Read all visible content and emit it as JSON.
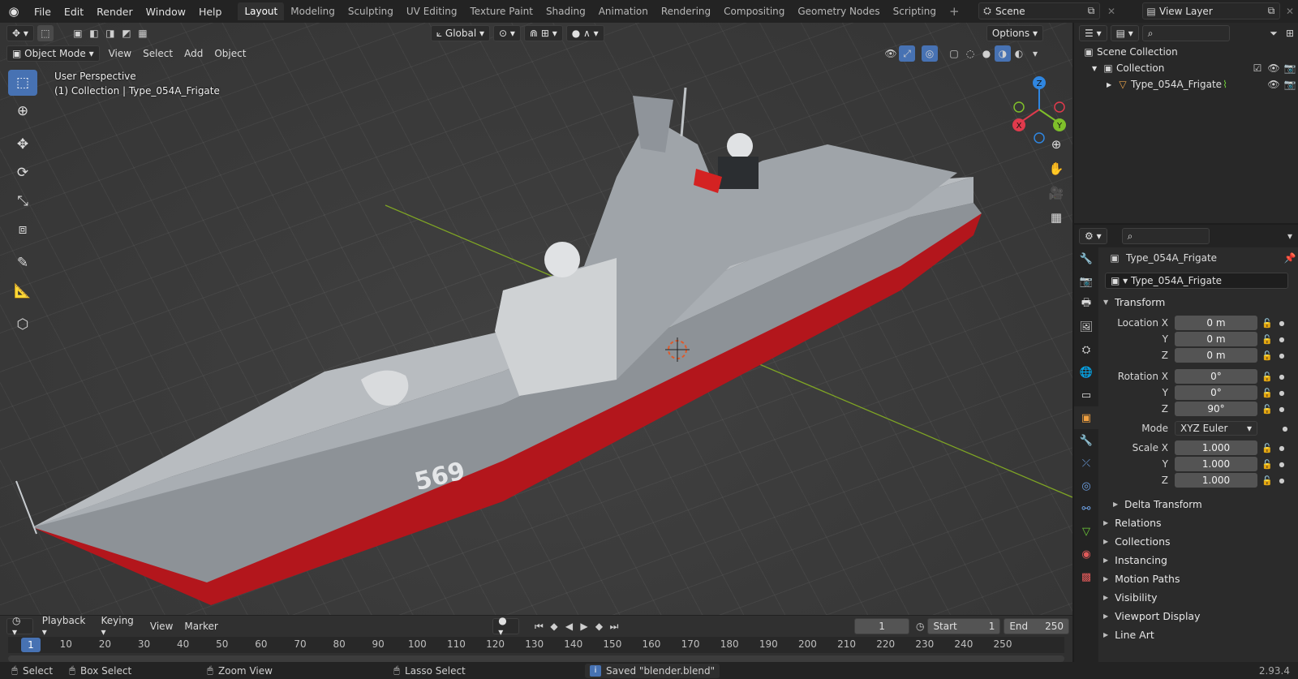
{
  "topbar": {
    "menus": [
      "File",
      "Edit",
      "Render",
      "Window",
      "Help"
    ],
    "workspaces": [
      "Layout",
      "Modeling",
      "Sculpting",
      "UV Editing",
      "Texture Paint",
      "Shading",
      "Animation",
      "Rendering",
      "Compositing",
      "Geometry Nodes",
      "Scripting"
    ],
    "active_workspace": "Layout",
    "scene": "Scene",
    "view_layer": "View Layer"
  },
  "viewport": {
    "orientation": "Global",
    "options_label": "Options",
    "mode": "Object Mode",
    "menus": [
      "View",
      "Select",
      "Add",
      "Object"
    ],
    "perspective_label": "User Perspective",
    "collection_label": "(1) Collection | Type_054A_Frigate",
    "hull_number": "569",
    "gizmo": {
      "z": "Z",
      "x": "X",
      "y": "Y"
    }
  },
  "outliner": {
    "scene_collection": "Scene Collection",
    "collection": "Collection",
    "object": "Type_054A_Frigate"
  },
  "properties": {
    "object_name": "Type_054A_Frigate",
    "data_name": "Type_054A_Frigate",
    "transform_label": "Transform",
    "location": {
      "label_x": "Location X",
      "label_y": "Y",
      "label_z": "Z",
      "x": "0 m",
      "y": "0 m",
      "z": "0 m"
    },
    "rotation": {
      "label_x": "Rotation X",
      "label_y": "Y",
      "label_z": "Z",
      "x": "0°",
      "y": "0°",
      "z": "90°"
    },
    "mode_label": "Mode",
    "mode_value": "XYZ Euler",
    "scale": {
      "label_x": "Scale X",
      "label_y": "Y",
      "label_z": "Z",
      "x": "1.000",
      "y": "1.000",
      "z": "1.000"
    },
    "delta_transform": "Delta Transform",
    "sections": [
      "Relations",
      "Collections",
      "Instancing",
      "Motion Paths",
      "Visibility",
      "Viewport Display",
      "Line Art"
    ]
  },
  "timeline": {
    "menus": [
      "Playback",
      "Keying",
      "View",
      "Marker"
    ],
    "current_frame": "1",
    "start_label": "Start",
    "start": "1",
    "end_label": "End",
    "end": "250",
    "ticks": [
      "1",
      "10",
      "20",
      "30",
      "40",
      "50",
      "60",
      "70",
      "80",
      "90",
      "100",
      "110",
      "120",
      "130",
      "140",
      "150",
      "160",
      "170",
      "180",
      "190",
      "200",
      "210",
      "220",
      "230",
      "240",
      "250"
    ]
  },
  "statusbar": {
    "select": "Select",
    "box_select": "Box Select",
    "zoom_view": "Zoom View",
    "lasso_select": "Lasso Select",
    "message": "Saved \"blender.blend\"",
    "version": "2.93.4"
  },
  "colors": {
    "accent": "#4772b3",
    "hull_red": "#b3161c",
    "hull_grey": "#a9aeb3",
    "axis_x": "#e03a4c",
    "axis_y": "#7fbf2a",
    "axis_z": "#2f86e0"
  }
}
